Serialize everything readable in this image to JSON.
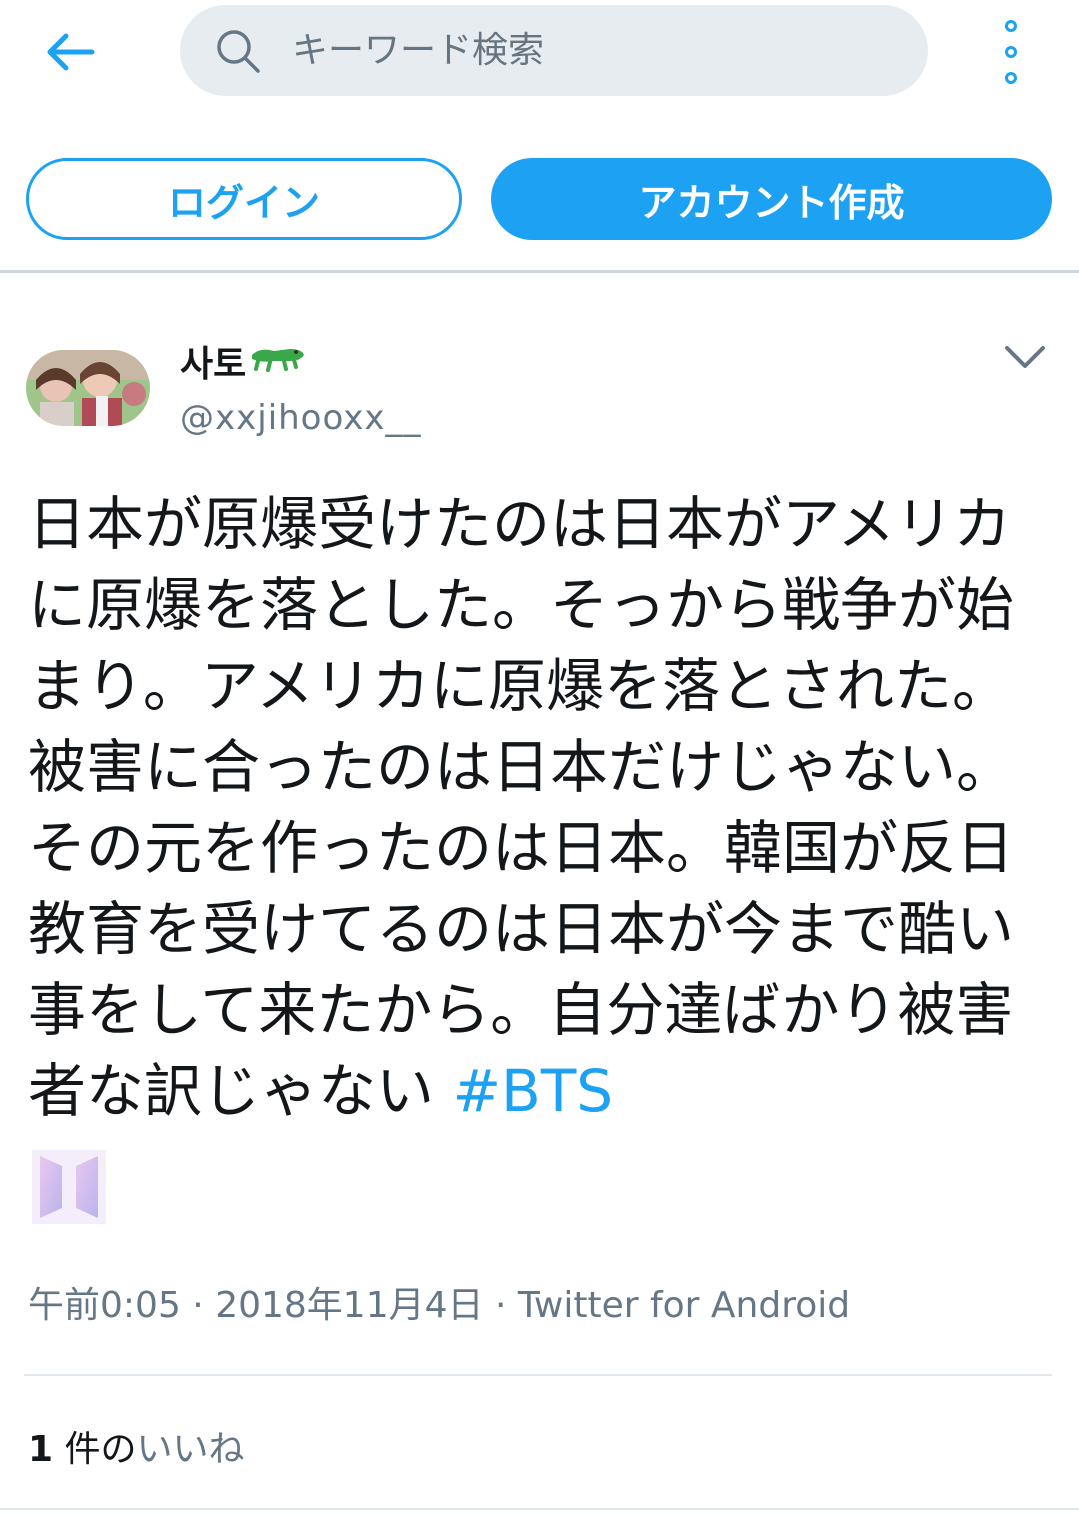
{
  "colors": {
    "accent": "#1da1f2",
    "text": "#14171a",
    "muted": "#657786",
    "search_bg": "#e6ecf0"
  },
  "header": {
    "back_icon": "arrow-left-icon",
    "search": {
      "placeholder": "キーワード検索",
      "icon": "search-icon"
    },
    "more_icon": "vertical-dots-icon"
  },
  "auth": {
    "login_label": "ログイン",
    "signup_label": "アカウント作成"
  },
  "tweet": {
    "display_name": "사토",
    "name_emoji": "crocodile-icon",
    "handle": "@xxjihooxx__",
    "menu_icon": "chevron-down-icon",
    "text": "日本が原爆受けたのは日本がアメリカに原爆を落とした。そっから戦争が始まり。アメリカに原爆を落とされた。被害に合ったのは日本だけじゃない。その元を作ったのは日本。韓国が反日教育を受けてるのは日本が今まで酷い事をして来たから。自分達ばかり被害者な訳じゃない ",
    "hashtag": "#BTS",
    "hashtag_emoji": "bts-army-logo-icon",
    "time": "午前0:05",
    "sep1": " · ",
    "date": "2018年11月4日",
    "sep2": " · ",
    "source": "Twitter for Android",
    "likes_count": "1",
    "likes_label_a": " 件の",
    "likes_label_b": "いいね"
  }
}
